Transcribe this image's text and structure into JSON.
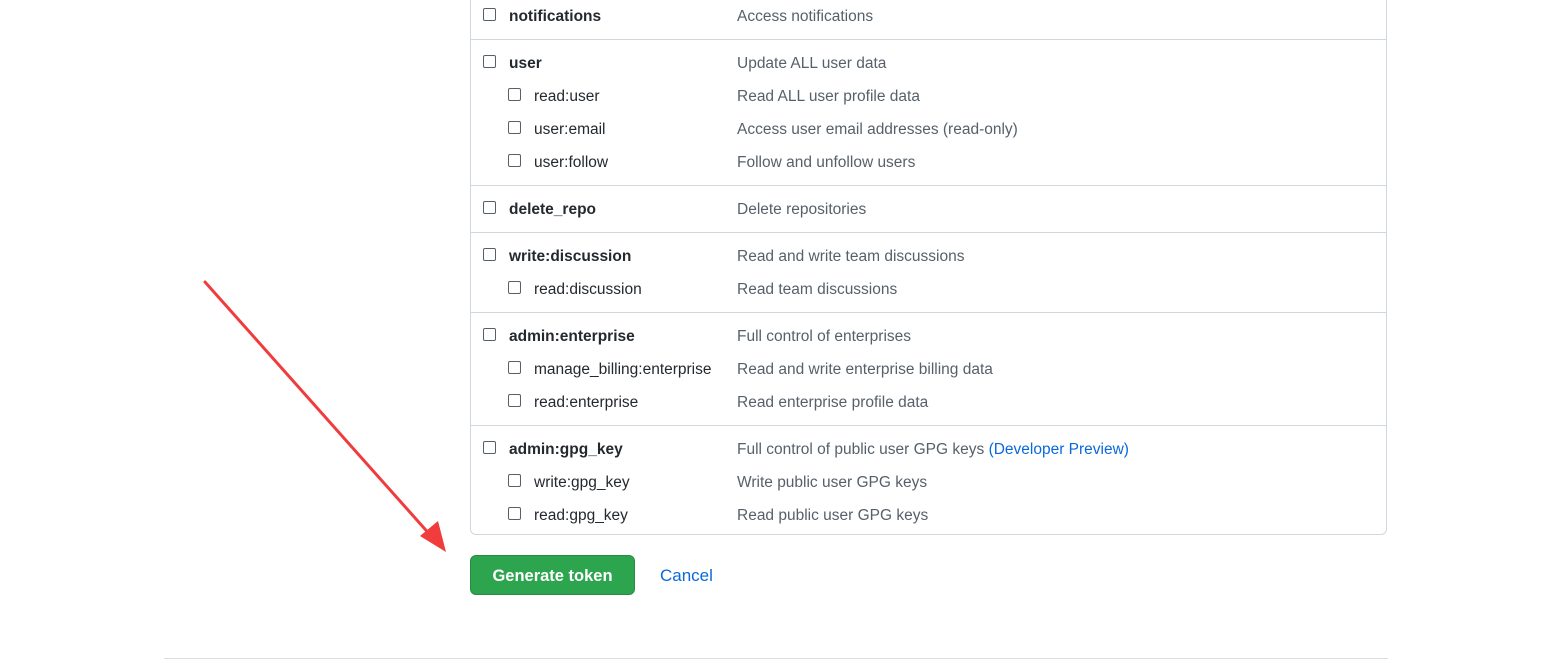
{
  "scopes": [
    {
      "name": "notifications",
      "desc": "Access notifications",
      "subs": []
    },
    {
      "name": "user",
      "desc": "Update ALL user data",
      "subs": [
        {
          "name": "read:user",
          "desc": "Read ALL user profile data"
        },
        {
          "name": "user:email",
          "desc": "Access user email addresses (read-only)"
        },
        {
          "name": "user:follow",
          "desc": "Follow and unfollow users"
        }
      ]
    },
    {
      "name": "delete_repo",
      "desc": "Delete repositories",
      "subs": []
    },
    {
      "name": "write:discussion",
      "desc": "Read and write team discussions",
      "subs": [
        {
          "name": "read:discussion",
          "desc": "Read team discussions"
        }
      ]
    },
    {
      "name": "admin:enterprise",
      "desc": "Full control of enterprises",
      "subs": [
        {
          "name": "manage_billing:enterprise",
          "desc": "Read and write enterprise billing data"
        },
        {
          "name": "read:enterprise",
          "desc": "Read enterprise profile data"
        }
      ]
    },
    {
      "name": "admin:gpg_key",
      "desc": "Full control of public user GPG keys",
      "desc_link": "(Developer Preview)",
      "subs": [
        {
          "name": "write:gpg_key",
          "desc": "Write public user GPG keys"
        },
        {
          "name": "read:gpg_key",
          "desc": "Read public user GPG keys"
        }
      ]
    }
  ],
  "actions": {
    "generate_label": "Generate token",
    "cancel_label": "Cancel"
  },
  "colors": {
    "primary_button": "#2da44e",
    "link": "#0969da",
    "annotation_arrow": "#f03c3c"
  },
  "annotation": {
    "icon": "red-arrow-icon"
  }
}
